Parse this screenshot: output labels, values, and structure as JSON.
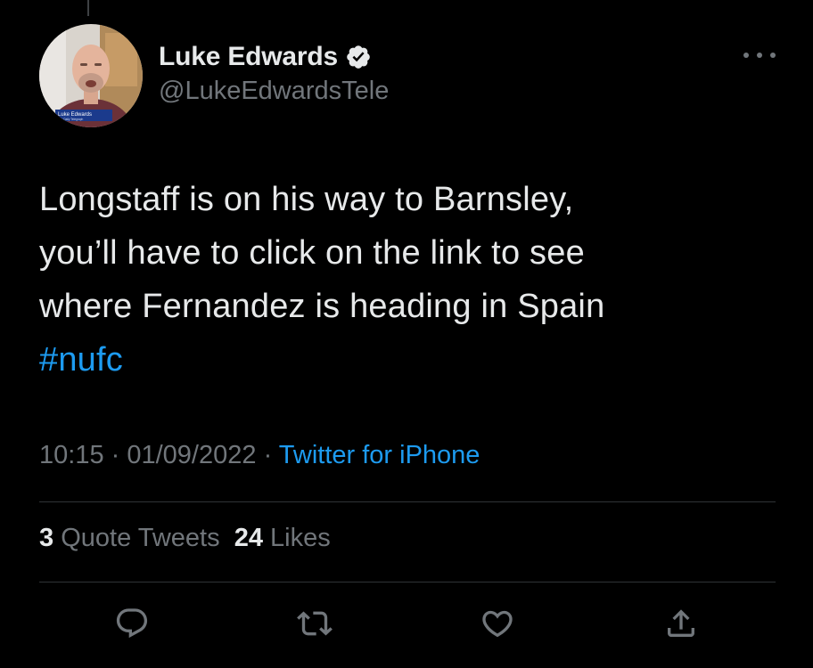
{
  "author": {
    "display_name": "Luke Edwards",
    "handle": "@LukeEdwardsTele",
    "verified": true,
    "avatar_caption_name": "Luke Edwards",
    "avatar_caption_org": "The Daily Telegraph"
  },
  "tweet": {
    "lines": [
      "Longstaff is on his way to Barnsley,",
      "you’ll have to click on the link to see",
      "where Fernandez is heading in Spain"
    ],
    "hashtag": "#nufc"
  },
  "meta": {
    "time": "10:15",
    "sep1": " · ",
    "date": "01/09/2022",
    "sep2": " · ",
    "source": "Twitter for iPhone"
  },
  "stats": {
    "quote_count": "3",
    "quote_label": " Quote Tweets",
    "likes_count": "24",
    "likes_label": " Likes"
  },
  "icons": {
    "more": "more-options-icon",
    "reply": "reply-icon",
    "retweet": "retweet-icon",
    "like": "like-icon",
    "share": "share-icon",
    "verified": "verified-badge-icon"
  },
  "colors": {
    "background": "#000000",
    "text": "#e7e9ea",
    "muted": "#71767b",
    "accent": "#1d9bf0",
    "divider": "#2f3336"
  }
}
